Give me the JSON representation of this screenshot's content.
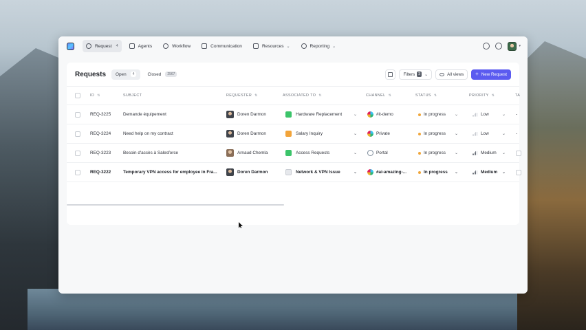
{
  "nav": {
    "items": [
      {
        "label": "Request",
        "badge": "4",
        "icon": "inbox-icon"
      },
      {
        "label": "Agents",
        "icon": "agents-icon"
      },
      {
        "label": "Workflow",
        "icon": "workflow-icon"
      },
      {
        "label": "Communication",
        "icon": "megaphone-icon"
      },
      {
        "label": "Resources",
        "icon": "layers-icon"
      },
      {
        "label": "Reporting",
        "icon": "chart-icon"
      }
    ]
  },
  "panel": {
    "title": "Requests",
    "tabs": [
      {
        "label": "Open",
        "count": "4"
      },
      {
        "label": "Closed",
        "count": "2567"
      }
    ],
    "filters_label": "Filters",
    "filters_count": "3",
    "views_label": "All views",
    "new_request_label": "New Request"
  },
  "table": {
    "columns": [
      "ID",
      "SUBJECT",
      "REQUESTER",
      "ASSOCIATED TO",
      "CHANNEL",
      "STATUS",
      "PRIORITY",
      "TA"
    ],
    "rows": [
      {
        "id": "REQ-3225",
        "subject": "Demande équipement",
        "requester": "Doren Darmon",
        "associated": "Hardware Replacement",
        "assoc_color": "#3cc46a",
        "channel": "#it-demo",
        "channel_type": "slack",
        "status": "In progress",
        "priority": "Low",
        "ta": "-"
      },
      {
        "id": "REQ-3224",
        "subject": "Need help on my contract",
        "requester": "Doren Darmon",
        "associated": "Salary Inquiry",
        "assoc_color": "#f2a43a",
        "channel": "Private",
        "channel_type": "slack",
        "status": "In progress",
        "priority": "Low",
        "ta": "-"
      },
      {
        "id": "REQ-3223",
        "subject": "Besoin d'accès à Salesforce",
        "requester": "Arnaud Chemla",
        "associated": "Access Requests",
        "assoc_color": "#3cc46a",
        "channel": "Portal",
        "channel_type": "portal",
        "status": "In progress",
        "priority": "Medium",
        "ta": ""
      },
      {
        "id": "REQ-3222",
        "subject": "Temporary VPN access for employee in Fra...",
        "requester": "Doren Darmon",
        "associated": "Network & VPN Issue",
        "assoc_color": "#e6e8ec",
        "channel": "#ai-amazing-...",
        "channel_type": "slack",
        "status": "In progress",
        "priority": "Medium",
        "ta": ""
      }
    ]
  },
  "colors": {
    "accent": "#5b5bf0",
    "status_in_progress": "#f0a63a"
  }
}
